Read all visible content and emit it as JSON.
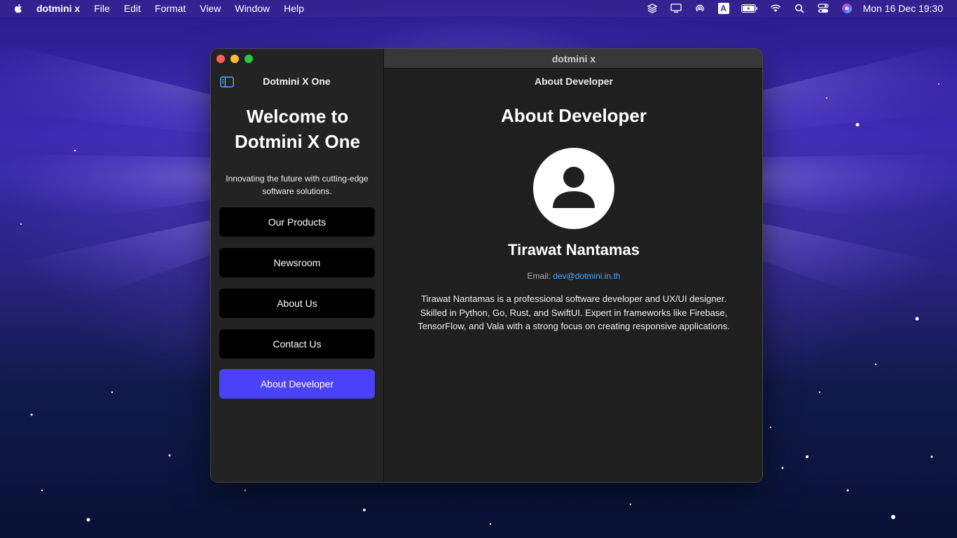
{
  "menubar": {
    "app_name": "dotmini x",
    "items": [
      "File",
      "Edit",
      "Format",
      "View",
      "Window",
      "Help"
    ],
    "input_indicator": "A",
    "clock": "Mon 16 Dec  19:30"
  },
  "window": {
    "title": "dotmini x",
    "sidebar": {
      "title": "Dotmini X One",
      "welcome_line1": "Welcome to",
      "welcome_line2": "Dotmini X One",
      "tagline_line1": "Innovating the future with cutting-edge",
      "tagline_line2": "software solutions.",
      "nav": [
        {
          "label": "Our Products",
          "active": false
        },
        {
          "label": "Newsroom",
          "active": false
        },
        {
          "label": "About Us",
          "active": false
        },
        {
          "label": "Contact Us",
          "active": false
        },
        {
          "label": "About Developer",
          "active": true
        }
      ]
    },
    "detail": {
      "nav_title": "About Developer",
      "heading": "About Developer",
      "name": "Tirawat Nantamas",
      "email_label": "Email:",
      "email": "dev@dotmini.in.th",
      "bio_line1": "Tirawat Nantamas is a professional software developer and UX/UI designer.",
      "bio_line2": "Skilled in Python, Go, Rust, and SwiftUI. Expert in frameworks like Firebase,",
      "bio_line3": "TensorFlow, and Vala with a strong focus on creating responsive applications."
    }
  },
  "colors": {
    "accent": "#4c42f5",
    "link": "#4aa8ff",
    "window_bg": "#1f1f1f",
    "sidebar_bg": "#232323"
  }
}
